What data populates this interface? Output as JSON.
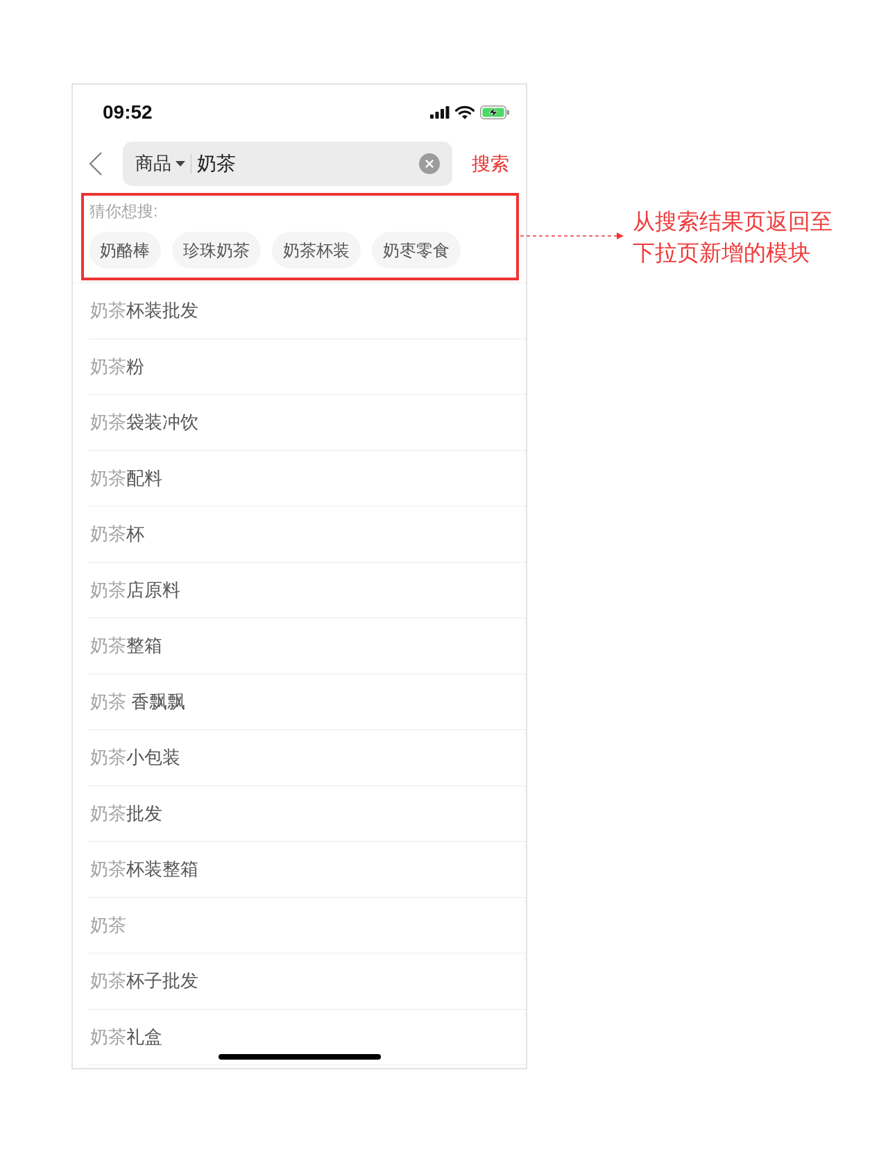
{
  "status_bar": {
    "time": "09:52"
  },
  "search_bar": {
    "category": "商品",
    "query": "奶茶",
    "submit": "搜索"
  },
  "suggestions_panel": {
    "title": "猜你想搜:",
    "chips": [
      "奶酪棒",
      "珍珠奶茶",
      "奶茶杯装",
      "奶枣零食"
    ]
  },
  "suggestion_list": [
    {
      "match": "奶茶",
      "suffix": "杯装批发"
    },
    {
      "match": "奶茶",
      "suffix": "粉"
    },
    {
      "match": "奶茶",
      "suffix": "袋装冲饮"
    },
    {
      "match": "奶茶",
      "suffix": "配料"
    },
    {
      "match": "奶茶",
      "suffix": "杯"
    },
    {
      "match": "奶茶",
      "suffix": "店原料"
    },
    {
      "match": "奶茶",
      "suffix": "整箱"
    },
    {
      "match": "奶茶",
      "suffix": " 香飘飘"
    },
    {
      "match": "奶茶",
      "suffix": "小包装"
    },
    {
      "match": "奶茶",
      "suffix": "批发"
    },
    {
      "match": "奶茶",
      "suffix": "杯装整箱"
    },
    {
      "match": "奶茶"
    },
    {
      "match": "奶茶",
      "suffix": "杯子批发"
    },
    {
      "match": "奶茶",
      "suffix": "礼盒"
    }
  ],
  "annotation": {
    "text": "从搜索结果页返回至下拉页新增的模块"
  }
}
